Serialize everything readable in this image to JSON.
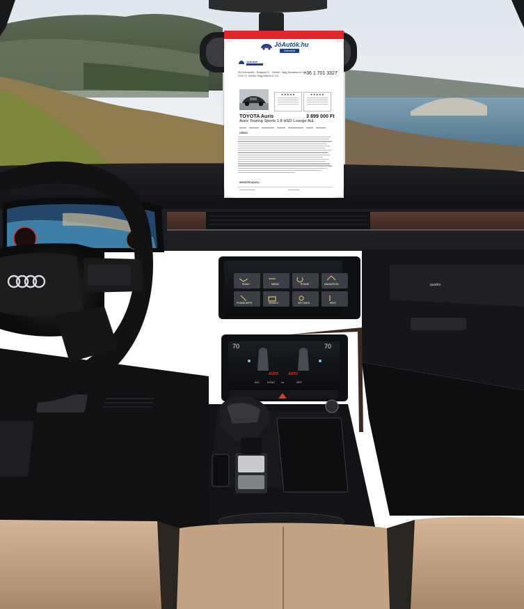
{
  "listing": {
    "site_name": "JóAutók.hu",
    "site_tag": "Garancia",
    "dealer_name": "JóAutók",
    "contact_line1": "Elő Kereskedés · Budapest XI. · Kerület · Nagy Budakeszi út 123.",
    "contact_line2": "1234 XX. Kerület, Nagy Bükkös út 123.",
    "phone": "+36 1 701 3327",
    "rating_stars": "★★★★★",
    "title": "TOYOTA Auris",
    "price": "3 899 000 Ft",
    "subtitle": "Auris Touring Sports 1.8 HSD Lounge AuL",
    "description_heading": "LEÍRÁS",
    "footer_heading": "HIRDETÉS ADATAI"
  },
  "infotainment_menu": [
    "RADIO",
    "MEDIA",
    "PHONE",
    "NAVIGATION",
    "PHONE APPS",
    "VEHICLE",
    "SETTINGS",
    "HELP"
  ],
  "climate": {
    "temp_left": "70",
    "temp_right": "70",
    "auto_left": "AUTO",
    "auto_right": "AUTO",
    "buttons": [
      "A/C",
      "SYNC",
      "•••",
      "OFF"
    ]
  },
  "steering_wheel_logo": "four-ring-logo",
  "model_badge": "quattro",
  "colors": {
    "sheet_red": "#e3262b",
    "brand_blue": "#1b3f8f",
    "leather": "#c9a98a",
    "dashboard": "#18191b"
  }
}
